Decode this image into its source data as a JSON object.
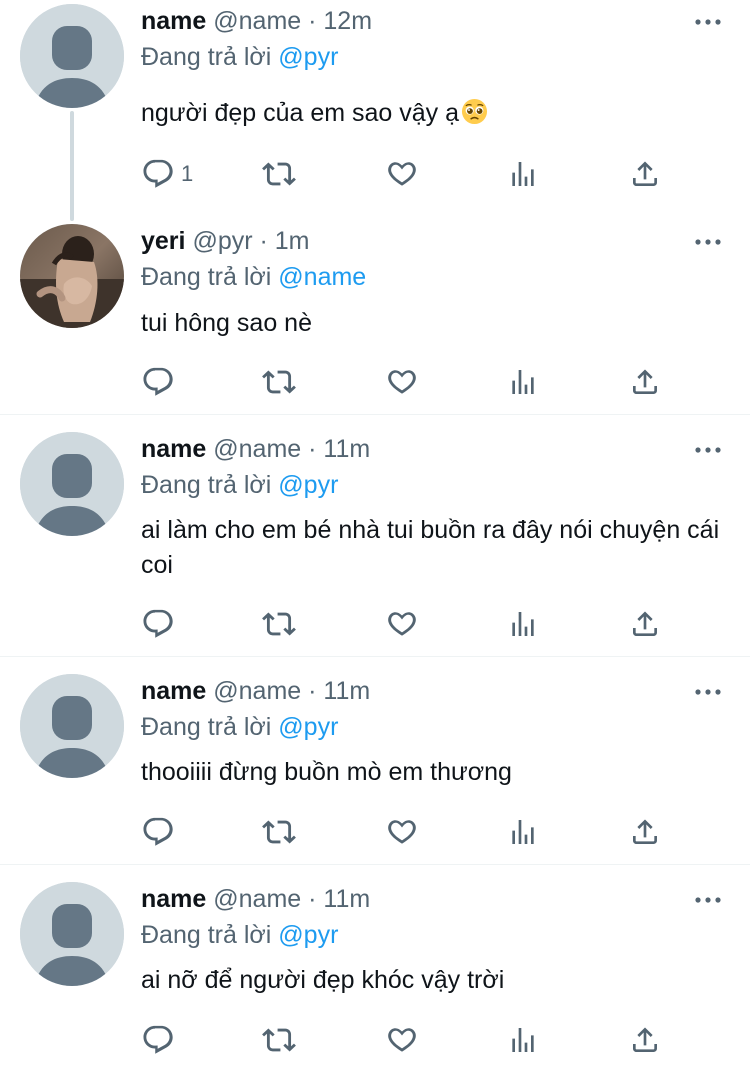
{
  "tweets": [
    {
      "name": "name",
      "meta": "@name · 12m",
      "replying_prefix": "Đang trả lời ",
      "replying_to": "@pyr",
      "text": "người đẹp của em sao vậy ạ",
      "emoji": "pleading-face-emoji",
      "reply_count": "1",
      "avatar": "default-avatar-icon"
    },
    {
      "name": "yeri",
      "meta": "@pyr · 1m",
      "replying_prefix": "Đang trả lời ",
      "replying_to": "@name",
      "text": "tui hông sao nè",
      "reply_count": "",
      "avatar": "profile-photo"
    },
    {
      "name": "name",
      "meta": "@name · 11m",
      "replying_prefix": "Đang trả lời ",
      "replying_to": "@pyr",
      "text": "ai làm cho em bé nhà tui buồn ra đây nói chuyện cái coi",
      "reply_count": "",
      "avatar": "default-avatar-icon"
    },
    {
      "name": "name",
      "meta": "@name · 11m",
      "replying_prefix": "Đang trả lời ",
      "replying_to": "@pyr",
      "text": "thooiiii đừng buồn mò em thương",
      "reply_count": "",
      "avatar": "default-avatar-icon"
    },
    {
      "name": "name",
      "meta": "@name · 11m",
      "replying_prefix": "Đang trả lời ",
      "replying_to": "@pyr",
      "text": "ai nỡ để người đẹp khóc vậy trời",
      "reply_count": "",
      "avatar": "default-avatar-icon"
    }
  ],
  "icons": {
    "reply": "reply-icon",
    "retweet": "retweet-icon",
    "like": "like-icon",
    "views": "views-icon",
    "share": "share-icon",
    "more": "more-icon"
  },
  "colors": {
    "text": "#0f1419",
    "secondary": "#536471",
    "mention": "#1d9bf0",
    "avatar_bg": "#cfd9de",
    "avatar_fg": "#657786",
    "divider": "#eff3f4"
  }
}
